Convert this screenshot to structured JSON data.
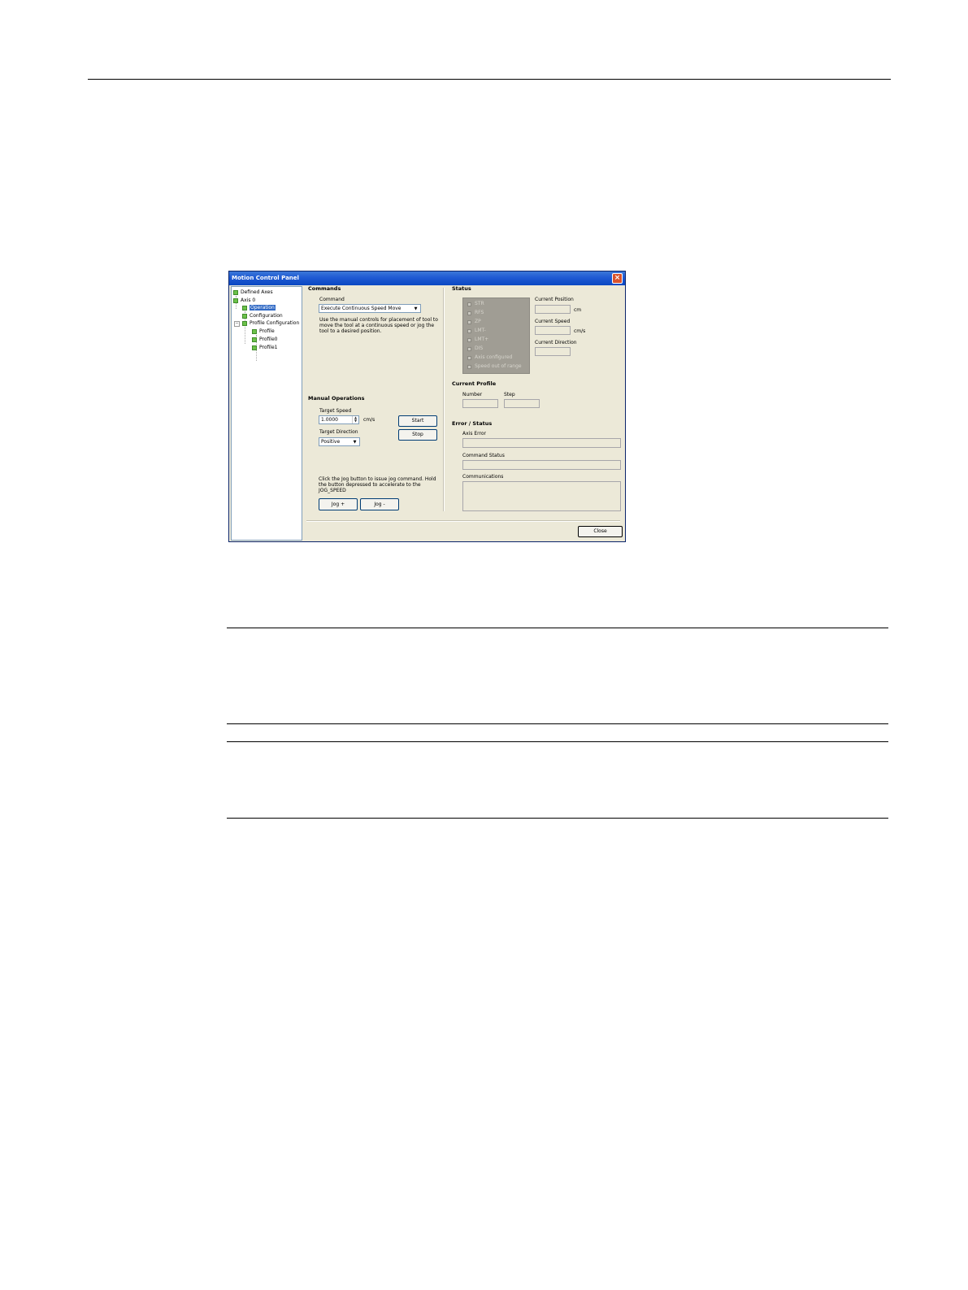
{
  "window": {
    "title": "Motion Control Panel"
  },
  "tree": {
    "items": [
      {
        "label": "Defined Axes"
      },
      {
        "label": "Axis 0"
      },
      {
        "label": "Operation"
      },
      {
        "label": "Configuration"
      },
      {
        "label": "Profile Configuration"
      },
      {
        "label": "Profile"
      },
      {
        "label": "Profile0"
      },
      {
        "label": "Profile1"
      }
    ],
    "expander": "−"
  },
  "commands": {
    "heading": "Commands",
    "command_label": "Command",
    "command_value": "Execute Continuous Speed Move",
    "description": "Use the manual controls for placement of tool to move the tool at a continuous speed or jog the tool to a desired position."
  },
  "manual": {
    "heading": "Manual Operations",
    "target_speed_label": "Target Speed",
    "target_speed_value": "1.0000",
    "target_speed_unit": "cm/s",
    "target_direction_label": "Target Direction",
    "target_direction_value": "Positive",
    "start_label": "Start",
    "stop_label": "Stop",
    "jog_note": "Click the Jog button to issue jog command.  Hold the button depressed to accelerate to the JOG_SPEED",
    "jog_plus_label": "Jog +",
    "jog_minus_label": "Jog -"
  },
  "status": {
    "heading": "Status",
    "flags": [
      {
        "label": "STR"
      },
      {
        "label": "RFS"
      },
      {
        "label": "ZP"
      },
      {
        "label": "LMT-"
      },
      {
        "label": "LMT+"
      },
      {
        "label": "DIS"
      },
      {
        "label": "Axis configured"
      },
      {
        "label": "Speed out of range"
      }
    ],
    "current_position_label": "Current Position",
    "position_unit": "cm",
    "current_speed_label": "Current Speed",
    "speed_unit": "cm/s",
    "current_direction_label": "Current Direction"
  },
  "current_profile": {
    "heading": "Current Profile",
    "number_label": "Number",
    "step_label": "Step"
  },
  "error_status": {
    "heading": "Error / Status",
    "axis_error_label": "Axis Error",
    "command_status_label": "Command Status",
    "communications_label": "Communications"
  },
  "footer": {
    "close_label": "Close"
  },
  "icons": {
    "window_close": "×",
    "dropdown_arrow": "▼",
    "spin_up": "▲",
    "spin_down": "▼"
  },
  "colors": {
    "titlebar": "#0a48c2",
    "window_bg": "#ece9d8",
    "tree_icon": "#6cc24a",
    "selection": "#316ac5",
    "status_panel": "#a09d94"
  }
}
